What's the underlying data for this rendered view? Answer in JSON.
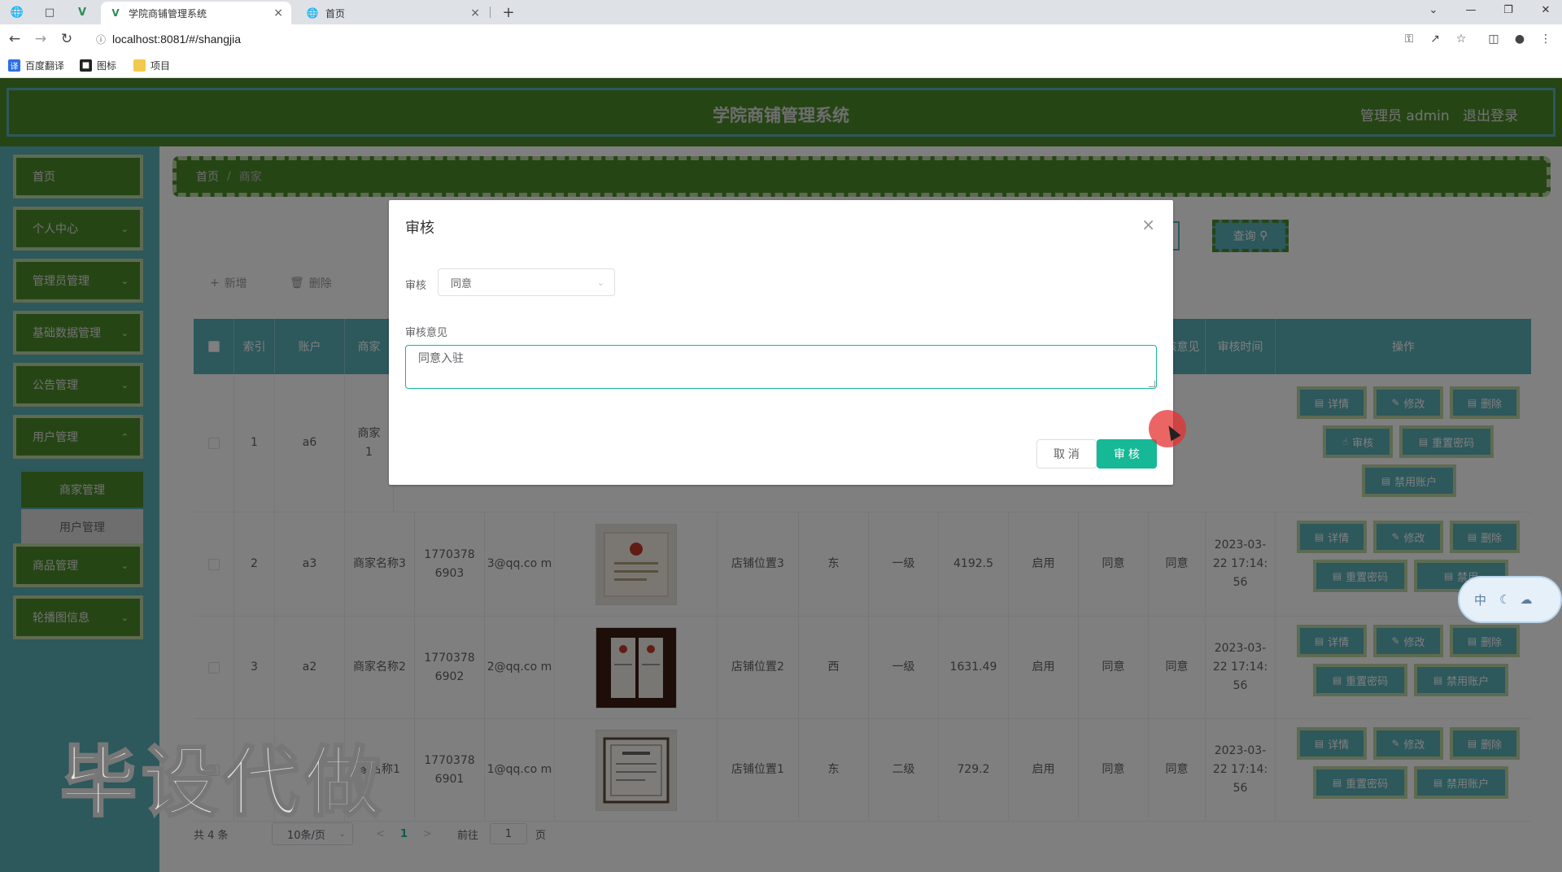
{
  "browser": {
    "tabs": [
      {
        "title": "学院商铺管理系统",
        "active": true
      },
      {
        "title": "首页",
        "active": false
      }
    ],
    "new_tab": "+",
    "url": "localhost:8081/#/shangjia",
    "bookmarks": [
      "百度翻译",
      "图标",
      "项目"
    ]
  },
  "header": {
    "title": "学院商铺管理系统",
    "user": "管理员 admin",
    "logout": "退出登录"
  },
  "sidebar": {
    "items": [
      {
        "label": "首页",
        "expandable": false
      },
      {
        "label": "个人中心",
        "expandable": true
      },
      {
        "label": "管理员管理",
        "expandable": true
      },
      {
        "label": "基础数据管理",
        "expandable": true
      },
      {
        "label": "公告管理",
        "expandable": true
      },
      {
        "label": "用户管理",
        "expandable": true
      },
      {
        "label": "商品管理",
        "expandable": true
      },
      {
        "label": "轮播图信息",
        "expandable": true
      }
    ],
    "subitems": [
      {
        "label": "商家管理",
        "active": true
      },
      {
        "label": "用户管理",
        "active": false
      }
    ]
  },
  "breadcrumb": {
    "home": "首页",
    "sep": "/",
    "current": "商家"
  },
  "toolbar": {
    "query": "查询",
    "add": "新增",
    "delete": "删除"
  },
  "table": {
    "headers": [
      "索引",
      "账户",
      "商家",
      "核意见",
      "审核时间",
      "操作"
    ],
    "rows": [
      {
        "index": "1",
        "account": "a6",
        "name": "商家",
        "name2": "1",
        "phone": "",
        "email": "",
        "location": "",
        "dir": "",
        "level": "",
        "balance": "",
        "status": "",
        "audit": "",
        "opinion": "",
        "time": ""
      },
      {
        "index": "2",
        "account": "a3",
        "name": "商家名称3",
        "phone": "1770378 6903",
        "email": "3@qq.co m",
        "location": "店铺位置3",
        "dir": "东",
        "level": "一级",
        "balance": "4192.5",
        "status": "启用",
        "audit": "同意",
        "opinion": "同意",
        "time": "2023-03- 22 17:14: 56"
      },
      {
        "index": "3",
        "account": "a2",
        "name": "商家名称2",
        "phone": "1770378 6902",
        "email": "2@qq.co m",
        "location": "店铺位置2",
        "dir": "西",
        "level": "一级",
        "balance": "1631.49",
        "status": "启用",
        "audit": "同意",
        "opinion": "同意",
        "time": "2023-03- 22 17:14: 56"
      },
      {
        "index": "",
        "account": "",
        "name": "家名称1",
        "phone": "1770378 6901",
        "email": "1@qq.co m",
        "location": "店铺位置1",
        "dir": "东",
        "level": "二级",
        "balance": "729.2",
        "status": "启用",
        "audit": "同意",
        "opinion": "同意",
        "time": "2023-03- 22 17:14: 56"
      }
    ],
    "ops": {
      "detail": "详情",
      "edit": "修改",
      "delete": "删除",
      "audit": "审核",
      "reset_pwd": "重置密码",
      "disable": "禁用账户",
      "disable_partial": "禁用"
    }
  },
  "pager": {
    "total": "共 4 条",
    "size": "10条/页",
    "page": "1",
    "goto": "前往",
    "goto_value": "1",
    "page_unit": "页"
  },
  "watermark": "毕设代做",
  "ime": {
    "label": "中"
  },
  "dialog": {
    "title": "审核",
    "audit_label": "审核",
    "audit_value": "同意",
    "opinion_label": "审核意见",
    "opinion_value": "同意入驻",
    "cancel": "取 消",
    "confirm": "审 核"
  },
  "colors": {
    "green": "#4d8a2a",
    "teal": "#5ab0b8",
    "accent": "#16b896"
  }
}
